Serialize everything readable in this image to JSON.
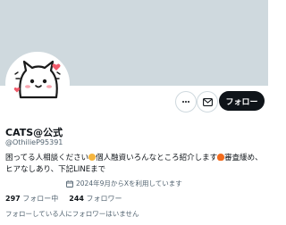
{
  "profile": {
    "display_name": "CATS@公式",
    "handle": "@OthilieP95391",
    "bio_part1": "困ってる人相談ください",
    "bio_part2": "個人融資いろんなところ紹介します",
    "bio_part3": "審査緩め、ヒアなしあり、下記LINEまで",
    "joined": "2024年9月からXを利用しています",
    "following_count": "297",
    "following_label": "フォロー中",
    "followers_count": "244",
    "followers_label": "フォロワー",
    "not_followed_note": "フォローしている人にフォロワーはいません"
  },
  "actions": {
    "follow_label": "フォロー",
    "more_icon": "more-icon",
    "message_icon": "mail-icon"
  },
  "colors": {
    "banner": "#cfd9de",
    "button_dark": "#0f1419",
    "secondary_text": "#536471",
    "emoji_hand": "#f5b53f",
    "emoji_fire": "#f26b1d"
  }
}
